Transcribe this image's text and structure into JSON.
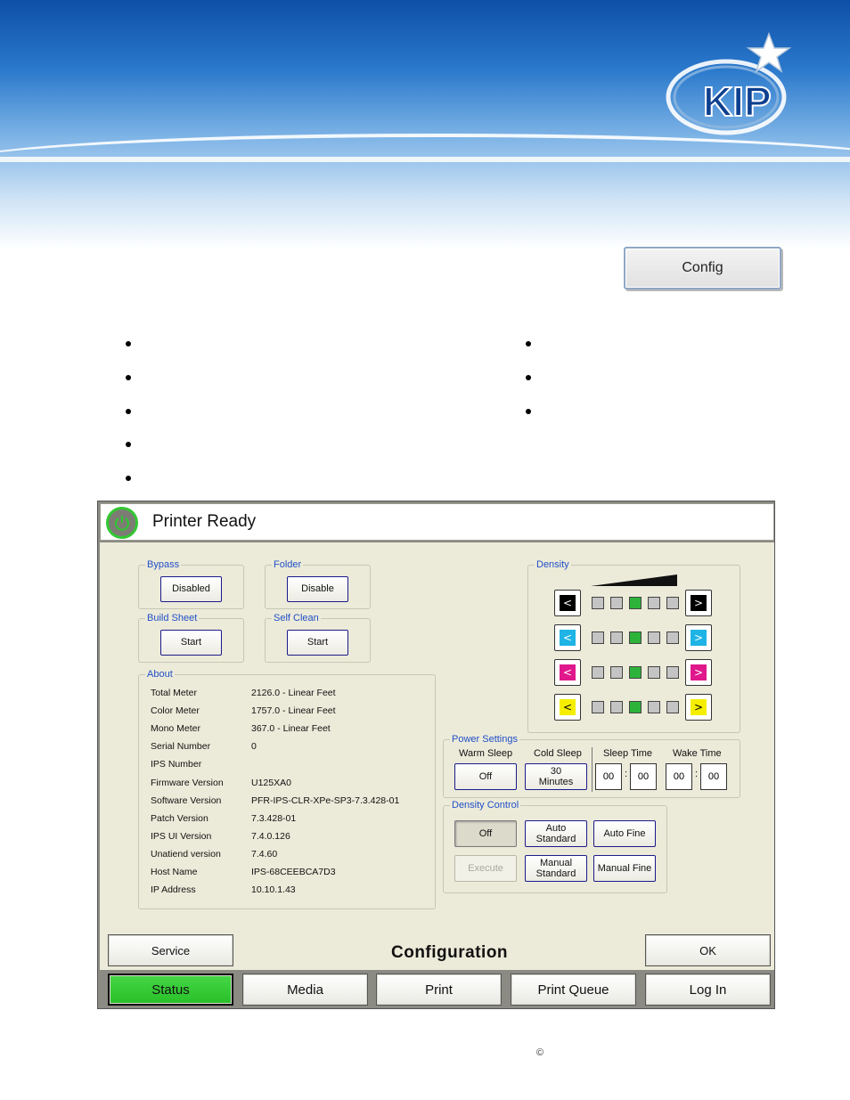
{
  "header": {
    "logo_text": "KIP",
    "config_button_label": "Config"
  },
  "screen": {
    "status_text": "Printer Ready",
    "title": "Configuration",
    "bypass": {
      "title": "Bypass",
      "button": "Disabled"
    },
    "folder": {
      "title": "Folder",
      "button": "Disable"
    },
    "build_sheet": {
      "title": "Build Sheet",
      "button": "Start"
    },
    "self_clean": {
      "title": "Self Clean",
      "button": "Start"
    },
    "about": {
      "title": "About",
      "rows": [
        {
          "label": "Total Meter",
          "value": "2126.0 - Linear Feet"
        },
        {
          "label": "Color Meter",
          "value": "1757.0 - Linear Feet"
        },
        {
          "label": "Mono Meter",
          "value": "367.0 - Linear Feet"
        },
        {
          "label": "Serial Number",
          "value": "0"
        },
        {
          "label": "IPS Number",
          "value": ""
        },
        {
          "label": "Firmware Version",
          "value": "U125XA0"
        },
        {
          "label": "Software Version",
          "value": "PFR-IPS-CLR-XPe-SP3-7.3.428-01"
        },
        {
          "label": "Patch Version",
          "value": "7.3.428-01"
        },
        {
          "label": "IPS UI Version",
          "value": "7.4.0.126"
        },
        {
          "label": "Unatiend version",
          "value": "7.4.60"
        },
        {
          "label": "Host Name",
          "value": "IPS-68CEEBCA7D3"
        },
        {
          "label": "IP Address",
          "value": "10.10.1.43"
        }
      ]
    },
    "density": {
      "title": "Density",
      "rows": [
        {
          "color": "#000000",
          "glyph_color": "#ffffff",
          "left": "<",
          "right": ">",
          "level": 3,
          "steps": 5
        },
        {
          "color": "#1eb4e6",
          "glyph_color": "#ffffff",
          "left": "<",
          "right": ">",
          "level": 3,
          "steps": 5
        },
        {
          "color": "#e0188c",
          "glyph_color": "#ffffff",
          "left": "<",
          "right": ">",
          "level": 3,
          "steps": 5
        },
        {
          "color": "#f5ee00",
          "glyph_color": "#000000",
          "left": "<",
          "right": ">",
          "level": 3,
          "steps": 5
        }
      ]
    },
    "power": {
      "title": "Power Settings",
      "warm_sleep_label": "Warm Sleep",
      "warm_sleep_value": "Off",
      "cold_sleep_label": "Cold Sleep",
      "cold_sleep_value_1": "30",
      "cold_sleep_value_2": "Minutes",
      "sleep_time_label": "Sleep Time",
      "sleep_hh": "00",
      "sleep_mm": "00",
      "wake_time_label": "Wake Time",
      "wake_hh": "00",
      "wake_mm": "00",
      "separator": ":"
    },
    "density_control": {
      "title": "Density Control",
      "off": "Off",
      "auto_standard_1": "Auto",
      "auto_standard_2": "Standard",
      "auto_fine": "Auto Fine",
      "execute": "Execute",
      "manual_standard_1": "Manual",
      "manual_standard_2": "Standard",
      "manual_fine": "Manual Fine"
    },
    "service_label": "Service",
    "ok_label": "OK",
    "tabs": [
      "Status",
      "Media",
      "Print",
      "Print Queue",
      "Log In"
    ]
  },
  "footer": {
    "copyright": "©"
  },
  "colors": {
    "status_green": "#2fc82f",
    "group_title": "#2050c8",
    "panel_bg": "#ecead9"
  }
}
